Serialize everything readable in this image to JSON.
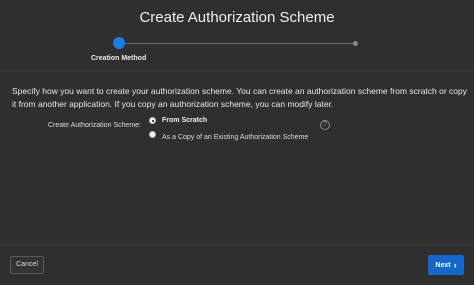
{
  "dialog": {
    "title": "Create Authorization Scheme"
  },
  "wizard": {
    "steps": [
      {
        "label": "Creation Method",
        "active": true
      },
      {
        "label": "",
        "active": false
      }
    ]
  },
  "intro": "Specify how you want to create your authorization scheme. You can create an authorization scheme from scratch or copy it from another application. If you copy an authorization scheme, you can modify later.",
  "form": {
    "label": "Create Authorization Scheme:",
    "options": [
      {
        "label": "From Scratch",
        "selected": true
      },
      {
        "label": "As a Copy of an Existing Authorization Scheme",
        "selected": false
      }
    ],
    "help_icon": "?"
  },
  "footer": {
    "cancel_label": "Cancel",
    "next_label": "Next",
    "next_icon": "chevron-right-icon"
  },
  "colors": {
    "accent": "#1568c9",
    "step_active": "#1b7fe0",
    "background": "#2f2f2f"
  }
}
